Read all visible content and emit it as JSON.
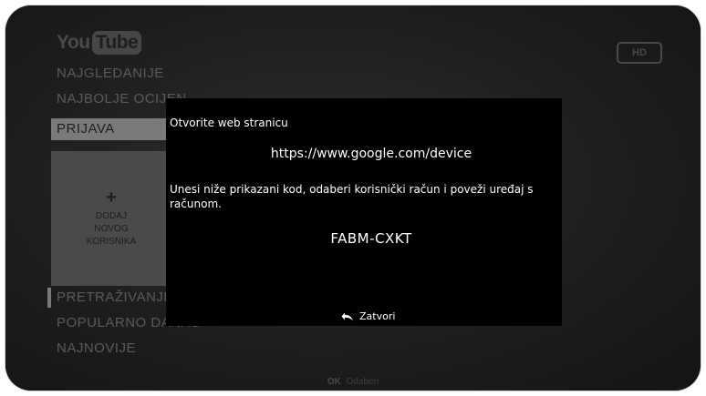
{
  "header": {
    "logo_you": "You",
    "logo_tube": "Tube",
    "hd_badge": "HD"
  },
  "menu": {
    "items_top": [
      {
        "label": "NAJGLEDANIJE"
      },
      {
        "label": "NAJBOLJE OCIJEN"
      },
      {
        "label": "PRIJAVA"
      }
    ],
    "add_user": {
      "plus": "+",
      "line1": "DODAJ",
      "line2": "NOVOG",
      "line3": "KORISNIKA"
    },
    "items_bottom": [
      {
        "label": "PRETRAŽIVANJE"
      },
      {
        "label": "POPULARNO DANAS"
      },
      {
        "label": "NAJNOVIJE"
      }
    ]
  },
  "dialog": {
    "title": "Otvorite web stranicu",
    "url": "https://www.google.com/device",
    "instructions": "Unesi niže prikazani kod, odaberi korisnički račun i poveži uređaj s računom.",
    "code": "FABM-CXKT",
    "close_label": "Zatvori"
  },
  "footer": {
    "ok_key": "OK",
    "ok_action": "Odaberi"
  },
  "colors": {
    "background": "#1b1b1b",
    "dialog": "#000000",
    "active_item": "#7a7a7a"
  }
}
